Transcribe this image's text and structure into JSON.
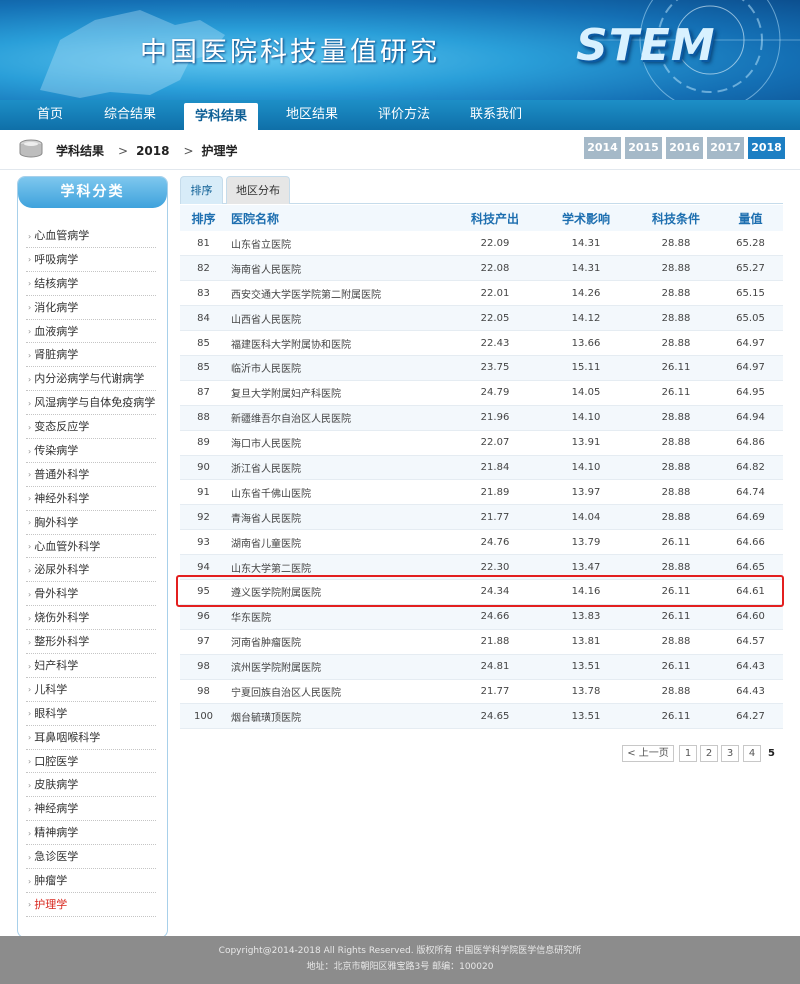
{
  "header": {
    "site_title": "中国医院科技量值研究",
    "logo_text": "STEM"
  },
  "nav": {
    "items": [
      {
        "label": "首页"
      },
      {
        "label": "综合结果"
      },
      {
        "label": "学科结果"
      },
      {
        "label": "地区结果"
      },
      {
        "label": "评价方法"
      },
      {
        "label": "联系我们"
      }
    ],
    "active_index": 2
  },
  "breadcrumb": {
    "items": [
      "学科结果",
      "2018",
      "护理学"
    ],
    "separator": ">"
  },
  "years": {
    "items": [
      "2014",
      "2015",
      "2016",
      "2017",
      "2018"
    ],
    "active": "2018"
  },
  "sidebar": {
    "title": "学科分类",
    "items": [
      "心血管病学",
      "呼吸病学",
      "结核病学",
      "消化病学",
      "血液病学",
      "肾脏病学",
      "内分泌病学与代谢病学",
      "风湿病学与自体免疫病学",
      "变态反应学",
      "传染病学",
      "普通外科学",
      "神经外科学",
      "胸外科学",
      "心血管外科学",
      "泌尿外科学",
      "骨外科学",
      "烧伤外科学",
      "整形外科学",
      "妇产科学",
      "儿科学",
      "眼科学",
      "耳鼻咽喉科学",
      "口腔医学",
      "皮肤病学",
      "神经病学",
      "精神病学",
      "急诊医学",
      "肿瘤学",
      "护理学"
    ],
    "active": "护理学"
  },
  "tabs": {
    "items": [
      "排序",
      "地区分布"
    ],
    "active": "排序"
  },
  "table": {
    "headers": [
      "排序",
      "医院名称",
      "科技产出",
      "学术影响",
      "科技条件",
      "量值"
    ],
    "rows": [
      [
        "81",
        "山东省立医院",
        "22.09",
        "14.31",
        "28.88",
        "65.28"
      ],
      [
        "82",
        "海南省人民医院",
        "22.08",
        "14.31",
        "28.88",
        "65.27"
      ],
      [
        "83",
        "西安交通大学医学院第二附属医院",
        "22.01",
        "14.26",
        "28.88",
        "65.15"
      ],
      [
        "84",
        "山西省人民医院",
        "22.05",
        "14.12",
        "28.88",
        "65.05"
      ],
      [
        "85",
        "福建医科大学附属协和医院",
        "22.43",
        "13.66",
        "28.88",
        "64.97"
      ],
      [
        "85",
        "临沂市人民医院",
        "23.75",
        "15.11",
        "26.11",
        "64.97"
      ],
      [
        "87",
        "复旦大学附属妇产科医院",
        "24.79",
        "14.05",
        "26.11",
        "64.95"
      ],
      [
        "88",
        "新疆维吾尔自治区人民医院",
        "21.96",
        "14.10",
        "28.88",
        "64.94"
      ],
      [
        "89",
        "海口市人民医院",
        "22.07",
        "13.91",
        "28.88",
        "64.86"
      ],
      [
        "90",
        "浙江省人民医院",
        "21.84",
        "14.10",
        "28.88",
        "64.82"
      ],
      [
        "91",
        "山东省千佛山医院",
        "21.89",
        "13.97",
        "28.88",
        "64.74"
      ],
      [
        "92",
        "青海省人民医院",
        "21.77",
        "14.04",
        "28.88",
        "64.69"
      ],
      [
        "93",
        "湖南省儿童医院",
        "24.76",
        "13.79",
        "26.11",
        "64.66"
      ],
      [
        "94",
        "山东大学第二医院",
        "22.30",
        "13.47",
        "28.88",
        "64.65"
      ],
      [
        "95",
        "遵义医学院附属医院",
        "24.34",
        "14.16",
        "26.11",
        "64.61"
      ],
      [
        "96",
        "华东医院",
        "24.66",
        "13.83",
        "26.11",
        "64.60"
      ],
      [
        "97",
        "河南省肿瘤医院",
        "21.88",
        "13.81",
        "28.88",
        "64.57"
      ],
      [
        "98",
        "滨州医学院附属医院",
        "24.81",
        "13.51",
        "26.11",
        "64.43"
      ],
      [
        "98",
        "宁夏回族自治区人民医院",
        "21.77",
        "13.78",
        "28.88",
        "64.43"
      ],
      [
        "100",
        "烟台毓璜顶医院",
        "24.65",
        "13.51",
        "26.11",
        "64.27"
      ]
    ],
    "highlighted_rank": "95",
    "highlight_color": "#e31f1f"
  },
  "pagination": {
    "prev_label": "< 上一页",
    "pages": [
      "1",
      "2",
      "3",
      "4"
    ],
    "current": "5"
  },
  "footer": {
    "line1": "Copyright@2014-2018 All Rights Reserved. 版权所有 中国医学科学院医学信息研究所",
    "line2": "地址：北京市朝阳区雅宝路3号 邮编：100020"
  },
  "colors": {
    "nav_bg": "#1d8fc7",
    "accent": "#1d7fc3",
    "active_sidebar": "#d8281f",
    "footer_bg": "#8c8c8c"
  }
}
